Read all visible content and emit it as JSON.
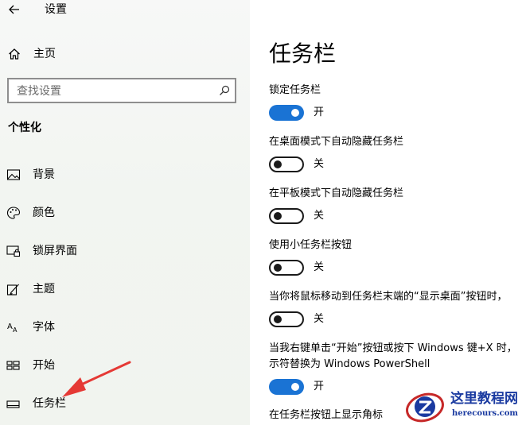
{
  "window": {
    "title": "设置"
  },
  "sidebar": {
    "home_label": "主页",
    "search_placeholder": "查找设置",
    "section_title": "个性化",
    "items": [
      {
        "label": "背景",
        "icon": "image-icon"
      },
      {
        "label": "颜色",
        "icon": "palette-icon"
      },
      {
        "label": "锁屏界面",
        "icon": "lock-screen-icon"
      },
      {
        "label": "主题",
        "icon": "theme-brush-icon"
      },
      {
        "label": "字体",
        "icon": "font-icon"
      },
      {
        "label": "开始",
        "icon": "start-menu-icon"
      },
      {
        "label": "任务栏",
        "icon": "taskbar-icon",
        "selected": true
      }
    ]
  },
  "main": {
    "page_title": "任务栏",
    "settings": [
      {
        "label": "锁定任务栏",
        "state": "开",
        "on": true
      },
      {
        "label": "在桌面模式下自动隐藏任务栏",
        "state": "关",
        "on": false
      },
      {
        "label": "在平板模式下自动隐藏任务栏",
        "state": "关",
        "on": false
      },
      {
        "label": "使用小任务栏按钮",
        "state": "关",
        "on": false
      },
      {
        "label": "当你将鼠标移动到任务栏末端的“显示桌面”按钮时，",
        "state": "关",
        "on": false
      },
      {
        "label": "当我右键单击“开始”按钮或按下 Windows 键+X 时，",
        "label2": "示符替换为 Windows PowerShell",
        "state": "开",
        "on": true
      },
      {
        "label": "在任务栏按钮上显示角标"
      }
    ]
  },
  "colors": {
    "accent": "#1a73d4",
    "annotation_arrow": "#e53935",
    "watermark": "#1a3aa0"
  },
  "watermark": {
    "title": "这里教程网",
    "url": "herecours.com"
  }
}
